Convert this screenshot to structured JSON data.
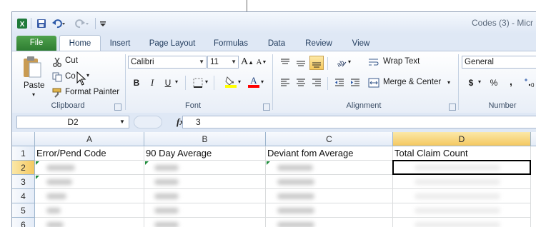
{
  "window": {
    "title": "Codes (3) - Micr",
    "quick_access": [
      "excel-logo-icon",
      "save-icon",
      "undo-icon",
      "redo-icon",
      "customize-icon"
    ]
  },
  "ribbon_tabs": [
    "File",
    "Home",
    "Insert",
    "Page Layout",
    "Formulas",
    "Data",
    "Review",
    "View"
  ],
  "clipboard": {
    "paste": "Paste",
    "cut": "Cut",
    "copy": "Co",
    "format_painter": "Format Painter",
    "group_label": "Clipboard"
  },
  "font": {
    "name": "Calibri",
    "size": "11",
    "group_label": "Font",
    "bold": "B",
    "italic": "I",
    "underline": "U",
    "grow": "A",
    "shrink": "A",
    "fill_color": "#ffff00",
    "font_color": "#ff0000"
  },
  "alignment": {
    "wrap_text": "Wrap Text",
    "merge_center": "Merge & Center",
    "group_label": "Alignment"
  },
  "number": {
    "format": "General",
    "group_label": "Number",
    "currency": "$",
    "percent": "%",
    "comma": ","
  },
  "formula_bar": {
    "name_box": "D2",
    "fx": "fx",
    "value": "3"
  },
  "sheet": {
    "columns": [
      "A",
      "B",
      "C",
      "D"
    ],
    "rows": [
      "1",
      "2",
      "3",
      "4",
      "5",
      "6"
    ],
    "header_cells": [
      "Error/Pend Code",
      "90 Day Average",
      "Deviant fom Average",
      "Total Claim Count"
    ]
  },
  "colors": {
    "file_tab": "#2e7d32",
    "ribbon_bg": "#dfe8f5",
    "error_indicator": "#1e8c3a"
  }
}
